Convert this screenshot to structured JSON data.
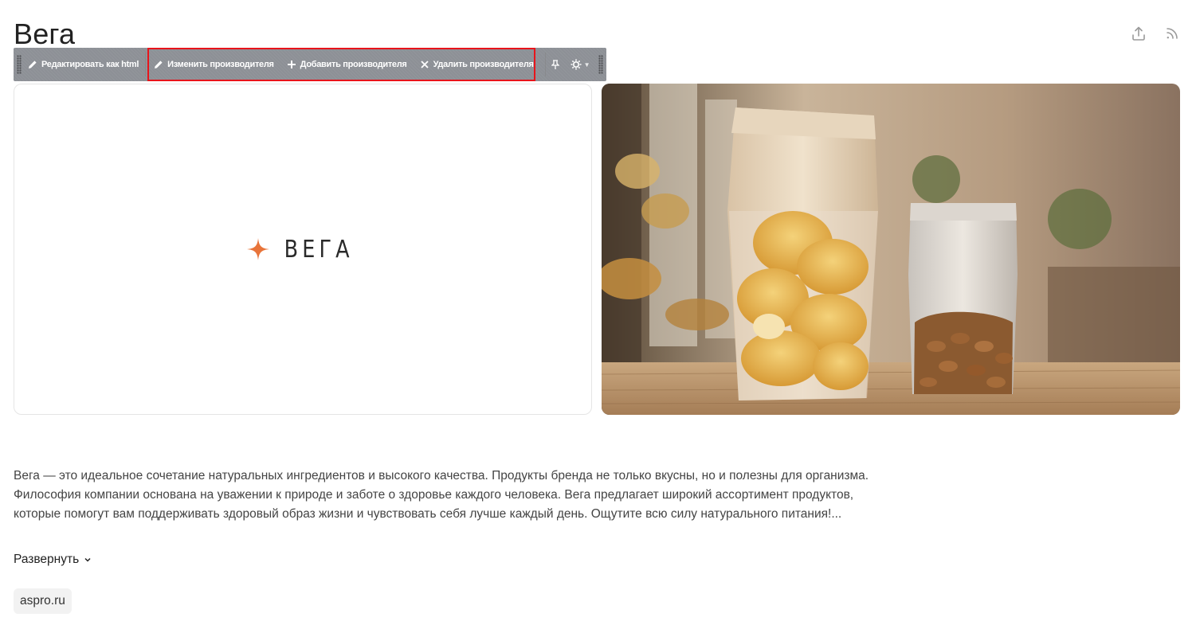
{
  "page": {
    "title": "Вега"
  },
  "top_actions": {
    "share_icon": "share-upload-icon",
    "rss_icon": "rss-icon"
  },
  "toolbar": {
    "edit_html_label": "Редактировать как html",
    "edit_vendor_label": "Изменить производителя",
    "add_vendor_label": "Добавить производителя",
    "delete_vendor_label": "Удалить производителя",
    "pin_icon": "pin-icon",
    "settings_icon": "gear-icon",
    "highlight_color": "#e8141b"
  },
  "brand": {
    "logo_text": "ВЕГА",
    "accent_color": "#e8743a"
  },
  "description": {
    "text": "Вега — это идеальное сочетание натуральных ингредиентов и высокого качества. Продукты бренда не только вкусны, но и полезны для организма. Философия компании основана на уважении к природе и заботе о здоровье каждого человека. Вега предлагает широкий ассортимент продуктов, которые помогут вам поддерживать здоровый образ жизни и чувствовать себя лучше каждый день. Ощутите всю силу натурального питания!...",
    "expand_label": "Развернуть"
  },
  "site_tag": {
    "label": "aspro.ru"
  }
}
